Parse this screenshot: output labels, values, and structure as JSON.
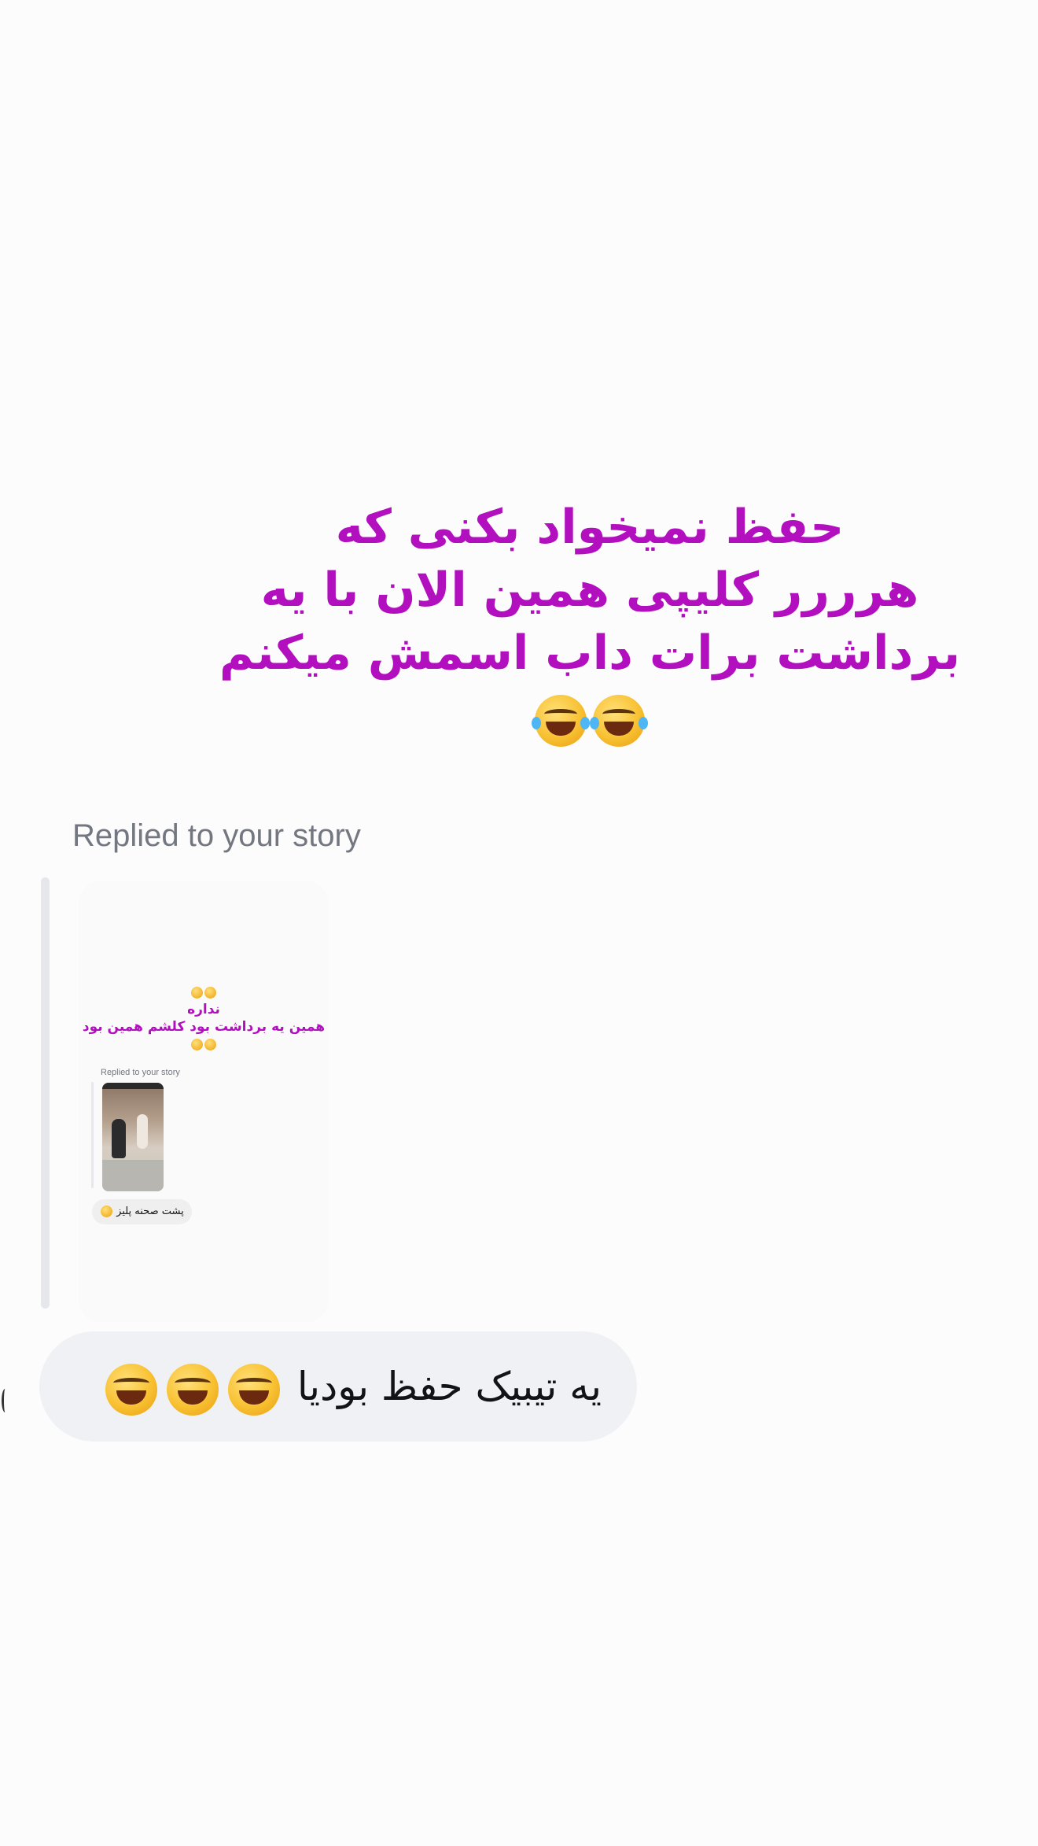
{
  "story": {
    "caption_lines": [
      "حفظ نمیخواد بکنی که",
      "هرررر کلیپی همین الان با یه",
      "برداشت برات داب اسمش میکنم"
    ],
    "caption_emoji": "rolling-on-floor-laughing"
  },
  "reply": {
    "label": "Replied to your story"
  },
  "thumbnail": {
    "caption_line1": "نداره",
    "caption_line2": "همین یه برداشت بود کلشم همین بود",
    "replied_label": "Replied to your story",
    "bubble_text": "پشت صحنه پلیز"
  },
  "message": {
    "text": "یه تیبیک حفظ بودیا",
    "emoji": "face-with-tears-of-joy"
  }
}
